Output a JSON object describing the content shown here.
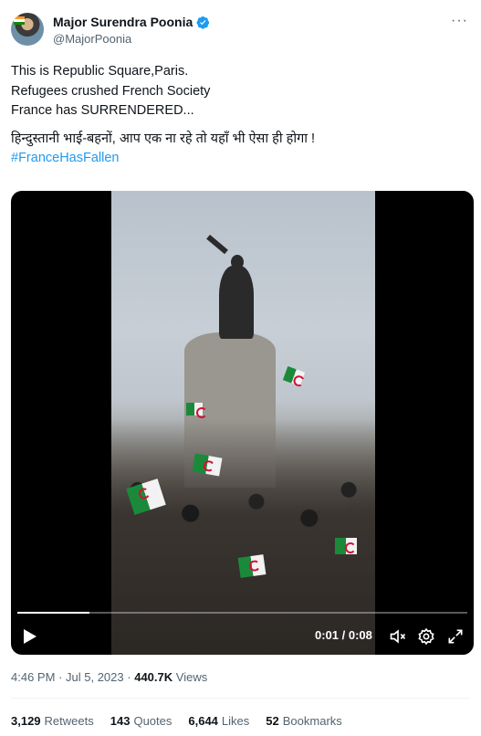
{
  "author": {
    "display_name": "Major Surendra Poonia",
    "handle": "@MajorPoonia",
    "verified_icon": "verified-badge-icon",
    "more_icon": "more-options-icon"
  },
  "tweet": {
    "lines": [
      "This is Republic Square,Paris.",
      "Refugees crushed French Society",
      "France has SURRENDERED..."
    ],
    "hindi_line": "हिन्दुस्तानी भाई-बहनों, आप एक ना रहे तो यहाँ भी ऐसा ही होगा !",
    "hashtag": "#FranceHasFallen"
  },
  "video": {
    "time_display": "0:01 / 0:08",
    "progress_fraction": 0.16,
    "icons": [
      "play-icon",
      "mute-icon",
      "settings-icon",
      "fullscreen-icon"
    ]
  },
  "meta": {
    "time": "4:46 PM",
    "separator1": "·",
    "date": "Jul 5, 2023",
    "separator2": "·",
    "views_count": "440.7K",
    "views_label": "Views"
  },
  "stats": {
    "retweets": {
      "count": "3,129",
      "label": "Retweets"
    },
    "quotes": {
      "count": "143",
      "label": "Quotes"
    },
    "likes": {
      "count": "6,644",
      "label": "Likes"
    },
    "bookmarks": {
      "count": "52",
      "label": "Bookmarks"
    }
  },
  "colors": {
    "accent": "#1d9bf0",
    "text_primary": "#0f1419",
    "text_secondary": "#536471"
  }
}
